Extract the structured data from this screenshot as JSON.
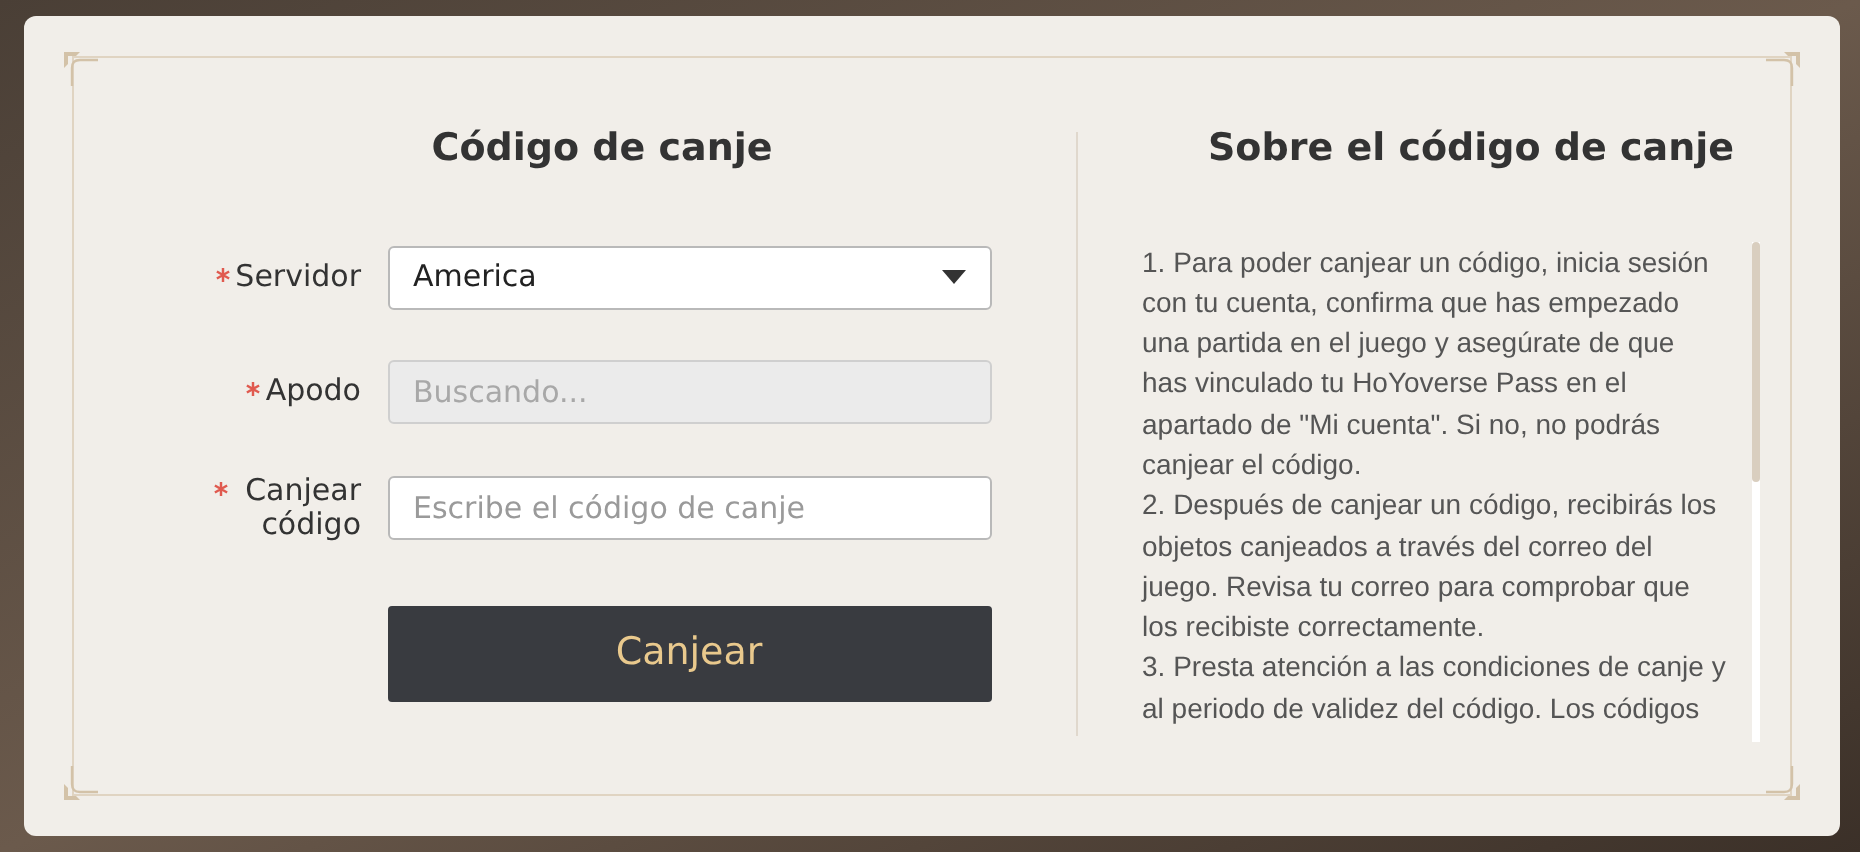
{
  "redeem_form": {
    "title": "Código de canje",
    "fields": [
      {
        "kind": "select",
        "label": "Servidor",
        "required": true,
        "value": "America"
      },
      {
        "kind": "disabled",
        "label": "Apodo",
        "required": true,
        "placeholder": "Buscando..."
      },
      {
        "kind": "text",
        "label": "Canjear código",
        "required": true,
        "placeholder": "Escribe el código de canje"
      }
    ],
    "submit": "Canjear"
  },
  "about": {
    "title": "Sobre el código de canje",
    "paragraphs": [
      "1. Para poder canjear un código, inicia sesión con tu cuenta, confirma que has empezado una partida en el juego y asegúrate de que has vinculado tu HoYoverse Pass en el apartado de \"Mi cuenta\". Si no, no podrás canjear el código.",
      "2. Después de canjear un código, recibirás los objetos canjeados a través del correo del juego. Revisa tu correo para comprobar que los recibiste correctamente.",
      "3. Presta atención a las condiciones de canje y al periodo de validez del código. Los códigos"
    ]
  }
}
